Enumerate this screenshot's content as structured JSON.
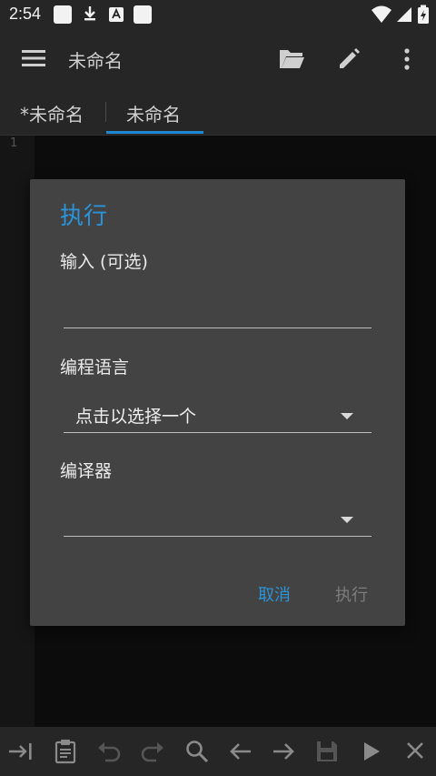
{
  "status_bar": {
    "time": "2:54",
    "icons": [
      "notification-square-icon",
      "download-icon",
      "translate-icon",
      "notification-square-icon",
      "wifi-icon",
      "signal-icon",
      "battery-charging-icon"
    ]
  },
  "app_bar": {
    "title": "未命名",
    "icons": [
      "menu-icon",
      "folder-open-icon",
      "pencil-icon",
      "more-vert-icon"
    ]
  },
  "tabs": [
    {
      "label": "*未命名",
      "active": false
    },
    {
      "label": "未命名",
      "active": true
    }
  ],
  "editor": {
    "line_numbers": [
      "1"
    ]
  },
  "dialog": {
    "title": "执行",
    "input_label": "输入 (可选)",
    "input_value": "",
    "language_label": "编程语言",
    "language_selected": "点击以选择一个",
    "compiler_label": "编译器",
    "compiler_selected": "",
    "cancel_label": "取消",
    "run_label": "执行"
  },
  "bottom_toolbar": {
    "icons": [
      "tab-indent-icon",
      "clipboard-icon",
      "undo-icon",
      "redo-icon",
      "search-icon",
      "arrow-left-icon",
      "arrow-right-icon",
      "save-icon",
      "play-icon",
      "close-icon"
    ]
  },
  "colors": {
    "accent": "#2b93d8",
    "bar_background": "#262626",
    "dialog_background": "#434343",
    "disabled_text": "#7d7d7d"
  }
}
